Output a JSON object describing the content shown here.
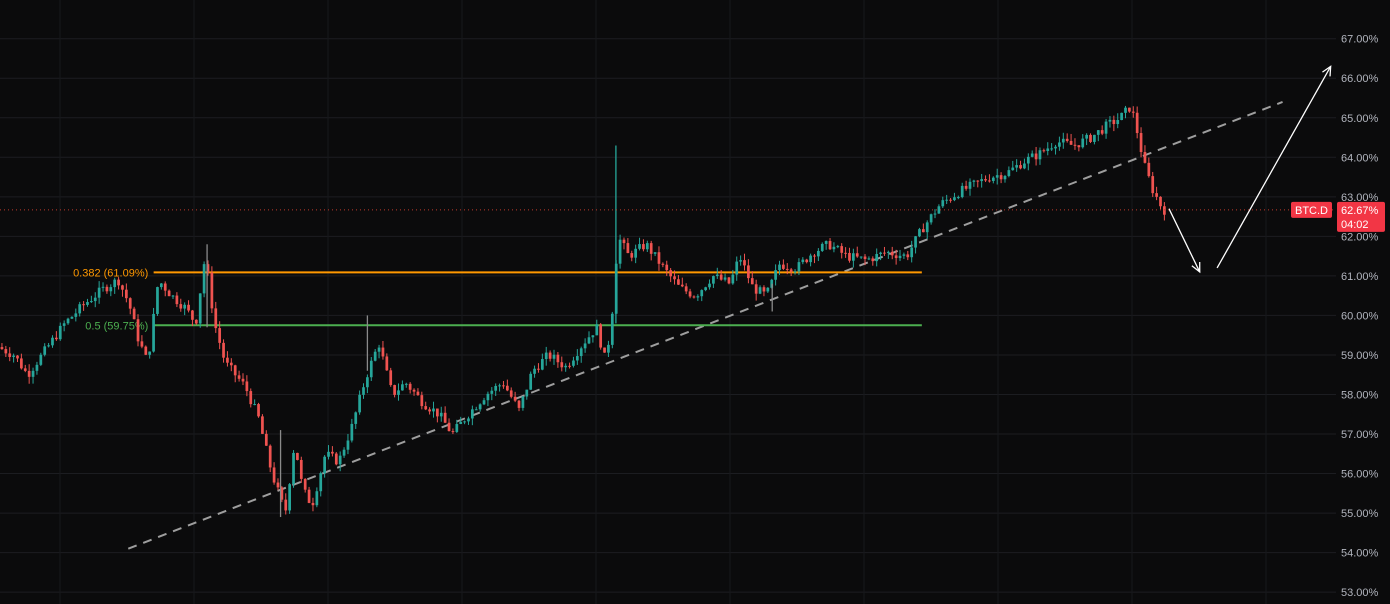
{
  "chart_data": {
    "type": "candlestick",
    "symbol": "BTC.D",
    "y_axis": {
      "ylim": [
        52.7,
        67.6
      ],
      "ticks": [
        "53.00%",
        "54.00%",
        "55.00%",
        "56.00%",
        "57.00%",
        "58.00%",
        "59.00%",
        "60.00%",
        "61.00%",
        "62.00%",
        "63.00%",
        "64.00%",
        "65.00%",
        "66.00%",
        "67.00%"
      ],
      "tick_values": [
        53,
        54,
        55,
        56,
        57,
        58,
        59,
        60,
        61,
        62,
        63,
        64,
        65,
        66,
        67
      ]
    },
    "grid": true,
    "last_price": {
      "value": 62.67,
      "label": "62.67%",
      "countdown": "04:02"
    },
    "colors": {
      "up": "#26a69a",
      "down": "#ef5350",
      "fib_0382": "#ff9800",
      "fib_05": "#4caf50",
      "trend": "#9e9e9e",
      "arrow": "#ffffff",
      "badge": "#f23645",
      "background": "#0b0b0c"
    },
    "fib_levels": [
      {
        "ratio": 0.382,
        "value": 61.09,
        "label": "0.382 (61.09%)"
      },
      {
        "ratio": 0.5,
        "value": 59.75,
        "label": "0.5 (59.75%)"
      }
    ],
    "trendline": {
      "from": {
        "t": 0.096,
        "y": 54.1
      },
      "to": {
        "t": 0.96,
        "y": 65.4
      }
    },
    "projection_arrows": [
      {
        "from": {
          "t": 0.875,
          "y": 62.7
        },
        "to": {
          "t": 0.898,
          "y": 61.1
        }
      },
      {
        "from": {
          "t": 0.911,
          "y": 61.2
        },
        "to": {
          "t": 0.996,
          "y": 66.3
        }
      }
    ],
    "price_path": [
      [
        0.0,
        59.2
      ],
      [
        0.012,
        59.0
      ],
      [
        0.022,
        58.5
      ],
      [
        0.035,
        59.1
      ],
      [
        0.05,
        59.8
      ],
      [
        0.065,
        60.3
      ],
      [
        0.08,
        60.7
      ],
      [
        0.09,
        60.9
      ],
      [
        0.098,
        60.3
      ],
      [
        0.105,
        59.4
      ],
      [
        0.112,
        58.8
      ],
      [
        0.12,
        60.9
      ],
      [
        0.13,
        60.5
      ],
      [
        0.14,
        60.2
      ],
      [
        0.148,
        59.8
      ],
      [
        0.155,
        61.5
      ],
      [
        0.162,
        59.8
      ],
      [
        0.17,
        58.8
      ],
      [
        0.185,
        58.2
      ],
      [
        0.195,
        57.4
      ],
      [
        0.205,
        56.0
      ],
      [
        0.215,
        55.0
      ],
      [
        0.222,
        56.8
      ],
      [
        0.228,
        55.6
      ],
      [
        0.235,
        55.2
      ],
      [
        0.245,
        56.5
      ],
      [
        0.255,
        56.3
      ],
      [
        0.265,
        57.2
      ],
      [
        0.275,
        58.4
      ],
      [
        0.285,
        59.3
      ],
      [
        0.295,
        58.0
      ],
      [
        0.305,
        58.3
      ],
      [
        0.318,
        57.8
      ],
      [
        0.33,
        57.5
      ],
      [
        0.34,
        57.0
      ],
      [
        0.352,
        57.5
      ],
      [
        0.365,
        58.0
      ],
      [
        0.378,
        58.3
      ],
      [
        0.39,
        57.6
      ],
      [
        0.4,
        58.6
      ],
      [
        0.412,
        59.0
      ],
      [
        0.425,
        58.7
      ],
      [
        0.438,
        59.3
      ],
      [
        0.448,
        59.7
      ],
      [
        0.455,
        58.8
      ],
      [
        0.46,
        60.2
      ],
      [
        0.464,
        62.0
      ],
      [
        0.472,
        61.5
      ],
      [
        0.485,
        61.8
      ],
      [
        0.498,
        61.2
      ],
      [
        0.51,
        60.7
      ],
      [
        0.522,
        60.5
      ],
      [
        0.535,
        61.0
      ],
      [
        0.548,
        60.8
      ],
      [
        0.555,
        61.5
      ],
      [
        0.565,
        60.7
      ],
      [
        0.575,
        60.5
      ],
      [
        0.585,
        61.3
      ],
      [
        0.598,
        61.2
      ],
      [
        0.61,
        61.6
      ],
      [
        0.622,
        61.8
      ],
      [
        0.635,
        61.5
      ],
      [
        0.65,
        61.4
      ],
      [
        0.665,
        61.6
      ],
      [
        0.68,
        61.5
      ],
      [
        0.692,
        62.2
      ],
      [
        0.705,
        62.8
      ],
      [
        0.718,
        63.1
      ],
      [
        0.73,
        63.3
      ],
      [
        0.742,
        63.5
      ],
      [
        0.755,
        63.6
      ],
      [
        0.768,
        63.9
      ],
      [
        0.78,
        64.1
      ],
      [
        0.792,
        64.4
      ],
      [
        0.805,
        64.3
      ],
      [
        0.818,
        64.5
      ],
      [
        0.83,
        64.8
      ],
      [
        0.84,
        65.0
      ],
      [
        0.848,
        65.3
      ],
      [
        0.853,
        64.6
      ],
      [
        0.858,
        63.8
      ],
      [
        0.864,
        63.2
      ],
      [
        0.87,
        62.8
      ],
      [
        0.873,
        62.67
      ]
    ],
    "spikes": [
      {
        "t": 0.155,
        "high": 61.8,
        "low": 59.7
      },
      {
        "t": 0.275,
        "high": 60.0,
        "low": 58.6
      },
      {
        "t": 0.461,
        "high": 64.3,
        "low": 59.8
      },
      {
        "t": 0.578,
        "high": 60.8,
        "low": 60.1
      },
      {
        "t": 0.21,
        "high": 57.1,
        "low": 54.9
      }
    ],
    "candle_count": 300
  }
}
